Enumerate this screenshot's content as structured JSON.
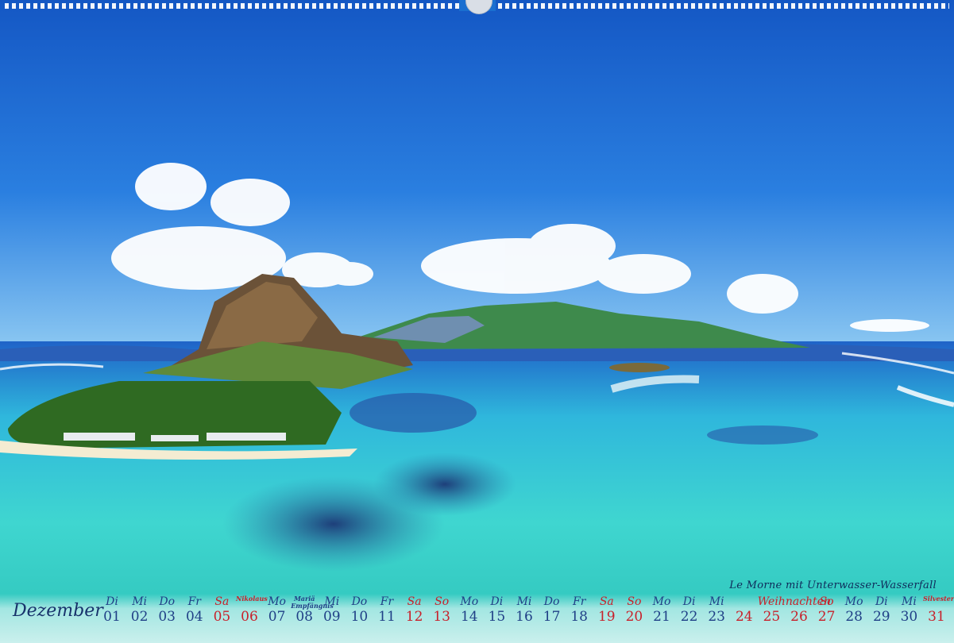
{
  "caption": "Le Morne mit Unterwasser-Wasserfall",
  "month": "Dezember",
  "colors": {
    "sky": "#1a6fd0",
    "lagoon": "#3fd0d8",
    "deep": "#1e4fa8",
    "weekday": "#1f3f86",
    "weekend": "#c8202a"
  },
  "days": [
    {
      "dow": "Di",
      "num": "01",
      "red": false
    },
    {
      "dow": "Mi",
      "num": "02",
      "red": false
    },
    {
      "dow": "Do",
      "num": "03",
      "red": false
    },
    {
      "dow": "Fr",
      "num": "04",
      "red": false
    },
    {
      "dow": "Sa",
      "num": "05",
      "red": true
    },
    {
      "dow": "Nikolaus",
      "num": "06",
      "red": true,
      "holiday": true
    },
    {
      "dow": "Mo",
      "num": "07",
      "red": false
    },
    {
      "dow": "Mariä Empfängnis",
      "num": "08",
      "red": false,
      "holiday": true
    },
    {
      "dow": "Mi",
      "num": "09",
      "red": false
    },
    {
      "dow": "Do",
      "num": "10",
      "red": false
    },
    {
      "dow": "Fr",
      "num": "11",
      "red": false
    },
    {
      "dow": "Sa",
      "num": "12",
      "red": true
    },
    {
      "dow": "So",
      "num": "13",
      "red": true
    },
    {
      "dow": "Mo",
      "num": "14",
      "red": false
    },
    {
      "dow": "Di",
      "num": "15",
      "red": false
    },
    {
      "dow": "Mi",
      "num": "16",
      "red": false
    },
    {
      "dow": "Do",
      "num": "17",
      "red": false
    },
    {
      "dow": "Fr",
      "num": "18",
      "red": false
    },
    {
      "dow": "Sa",
      "num": "19",
      "red": true
    },
    {
      "dow": "So",
      "num": "20",
      "red": true
    },
    {
      "dow": "Mo",
      "num": "21",
      "red": false
    },
    {
      "dow": "Di",
      "num": "22",
      "red": false
    },
    {
      "dow": "Mi",
      "num": "23",
      "red": false
    },
    {
      "dow": "Weihnachten",
      "num": "24",
      "red": true
    },
    {
      "dow": "",
      "num": "25",
      "red": true
    },
    {
      "dow": "",
      "num": "26",
      "red": true
    },
    {
      "dow": "So",
      "num": "27",
      "red": true
    },
    {
      "dow": "Mo",
      "num": "28",
      "red": false
    },
    {
      "dow": "Di",
      "num": "29",
      "red": false
    },
    {
      "dow": "Mi",
      "num": "30",
      "red": false
    },
    {
      "dow": "Silvester",
      "num": "31",
      "red": true,
      "holiday": true
    }
  ]
}
